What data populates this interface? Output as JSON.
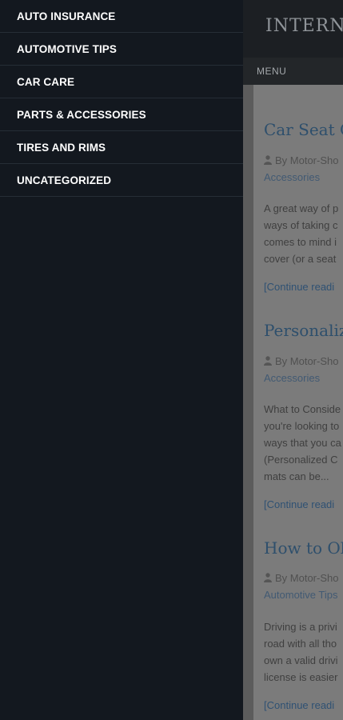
{
  "sidebar": {
    "items": [
      {
        "label": "AUTO INSURANCE"
      },
      {
        "label": "AUTOMOTIVE TIPS"
      },
      {
        "label": "CAR CARE"
      },
      {
        "label": "PARTS & ACCESSORIES"
      },
      {
        "label": "TIRES AND RIMS"
      },
      {
        "label": "UNCATEGORIZED"
      }
    ]
  },
  "header": {
    "site_title": "INTERNA",
    "menu_label": "MENU"
  },
  "posts": [
    {
      "title": "Car Seat Co",
      "meta_line1": "By Motor-Sho",
      "meta_line2": "Accessories",
      "excerpt_lines": [
        "A great way of p",
        "ways of taking c",
        "comes to mind i",
        "cover (or a seat"
      ],
      "read_more": "[Continue readi"
    },
    {
      "title": "Personaliz",
      "meta_line1": "By Motor-Sho",
      "meta_line2": "Accessories",
      "excerpt_lines": [
        "What to Conside",
        "you're looking to",
        "ways that you ca",
        "(Personalized C",
        "mats can be..."
      ],
      "read_more": "[Continue readi"
    },
    {
      "title": "How to Ob",
      "meta_line1": "By Motor-Sho",
      "meta_line2": "Automotive Tips",
      "excerpt_lines": [
        "Driving is a privi",
        "road with all tho",
        "own a valid drivi",
        "license is easier"
      ],
      "read_more": "[Continue readi"
    }
  ],
  "colors": {
    "drawer_bg": "#13181f",
    "overlay_content": "#5c5c5c",
    "link_blue": "#2e4f6c"
  },
  "icons": {
    "author": "user-icon"
  }
}
